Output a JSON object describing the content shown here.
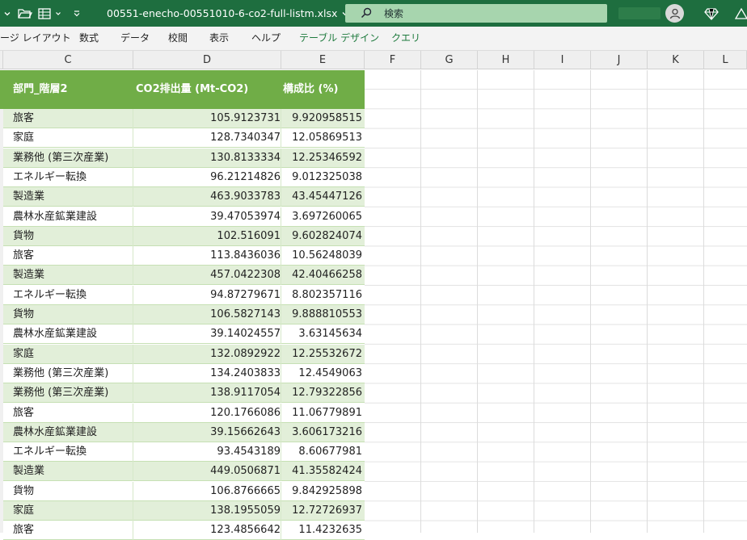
{
  "titlebar": {
    "filename": "00551-enecho-00551010-6-co2-full-listm.xlsx",
    "search_label": "検索"
  },
  "ribbon": {
    "tabs": [
      {
        "label": "ージ レイアウト",
        "green": false
      },
      {
        "label": "数式",
        "green": false
      },
      {
        "label": "データ",
        "green": false
      },
      {
        "label": "校閲",
        "green": false
      },
      {
        "label": "表示",
        "green": false
      },
      {
        "label": "ヘルプ",
        "green": false
      },
      {
        "label": "テーブル デザイン",
        "green": true
      },
      {
        "label": "クエリ",
        "green": true
      }
    ]
  },
  "columns": [
    "C",
    "D",
    "E",
    "F",
    "G",
    "H",
    "I",
    "J",
    "K",
    "L"
  ],
  "table": {
    "headers": [
      "部門_階層2",
      "CO2排出量 (Mt-CO2)",
      "構成比 (%)"
    ],
    "rows": [
      [
        "旅客",
        "105.9123731",
        "9.920958515"
      ],
      [
        "家庭",
        "128.7340347",
        "12.05869513"
      ],
      [
        "業務他 (第三次産業)",
        "130.8133334",
        "12.25346592"
      ],
      [
        "エネルギー転換",
        "96.21214826",
        "9.012325038"
      ],
      [
        "製造業",
        "463.9033783",
        "43.45447126"
      ],
      [
        "農林水産鉱業建設",
        "39.47053974",
        "3.697260065"
      ],
      [
        "貨物",
        "102.516091",
        "9.602824074"
      ],
      [
        "旅客",
        "113.8436036",
        "10.56248039"
      ],
      [
        "製造業",
        "457.0422308",
        "42.40466258"
      ],
      [
        "エネルギー転換",
        "94.87279671",
        "8.802357116"
      ],
      [
        "貨物",
        "106.5827143",
        "9.888810553"
      ],
      [
        "農林水産鉱業建設",
        "39.14024557",
        "3.63145634"
      ],
      [
        "家庭",
        "132.0892922",
        "12.25532672"
      ],
      [
        "業務他 (第三次産業)",
        "134.2403833",
        "12.4549063"
      ],
      [
        "業務他 (第三次産業)",
        "138.9117054",
        "12.79322856"
      ],
      [
        "旅客",
        "120.1766086",
        "11.06779891"
      ],
      [
        "農林水産鉱業建設",
        "39.15662643",
        "3.606173216"
      ],
      [
        "エネルギー転換",
        "93.4543189",
        "8.60677981"
      ],
      [
        "製造業",
        "449.0506871",
        "41.35582424"
      ],
      [
        "貨物",
        "106.8766665",
        "9.842925898"
      ],
      [
        "家庭",
        "138.1955059",
        "12.72726937"
      ],
      [
        "旅客",
        "123.4856642",
        "11.4232635"
      ]
    ]
  }
}
